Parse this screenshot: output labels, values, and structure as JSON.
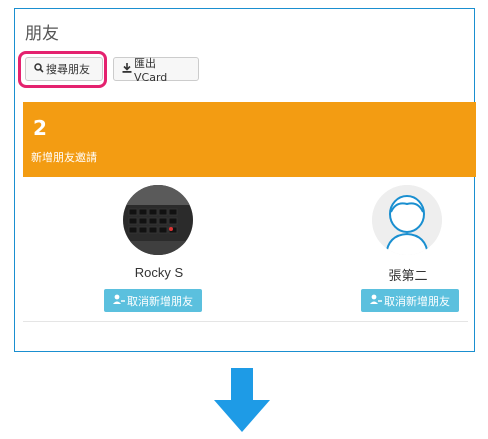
{
  "panel": {
    "title": "朋友",
    "buttons": {
      "search_label": "搜尋朋友",
      "export_label": "匯出 VCard"
    }
  },
  "requests": {
    "count": "2",
    "label": "新增朋友邀請",
    "color": "#f39c12",
    "items": [
      {
        "name": "Rocky S",
        "action": "取消新增朋友",
        "avatar": "laptop-photo"
      },
      {
        "name": "張第二",
        "action": "取消新增朋友",
        "avatar": "default-person-icon"
      }
    ]
  },
  "colors": {
    "highlight": "#e4226f",
    "panel_border": "#1a8fd0",
    "action_button": "#5bc0de",
    "arrow": "#1e9be6"
  }
}
